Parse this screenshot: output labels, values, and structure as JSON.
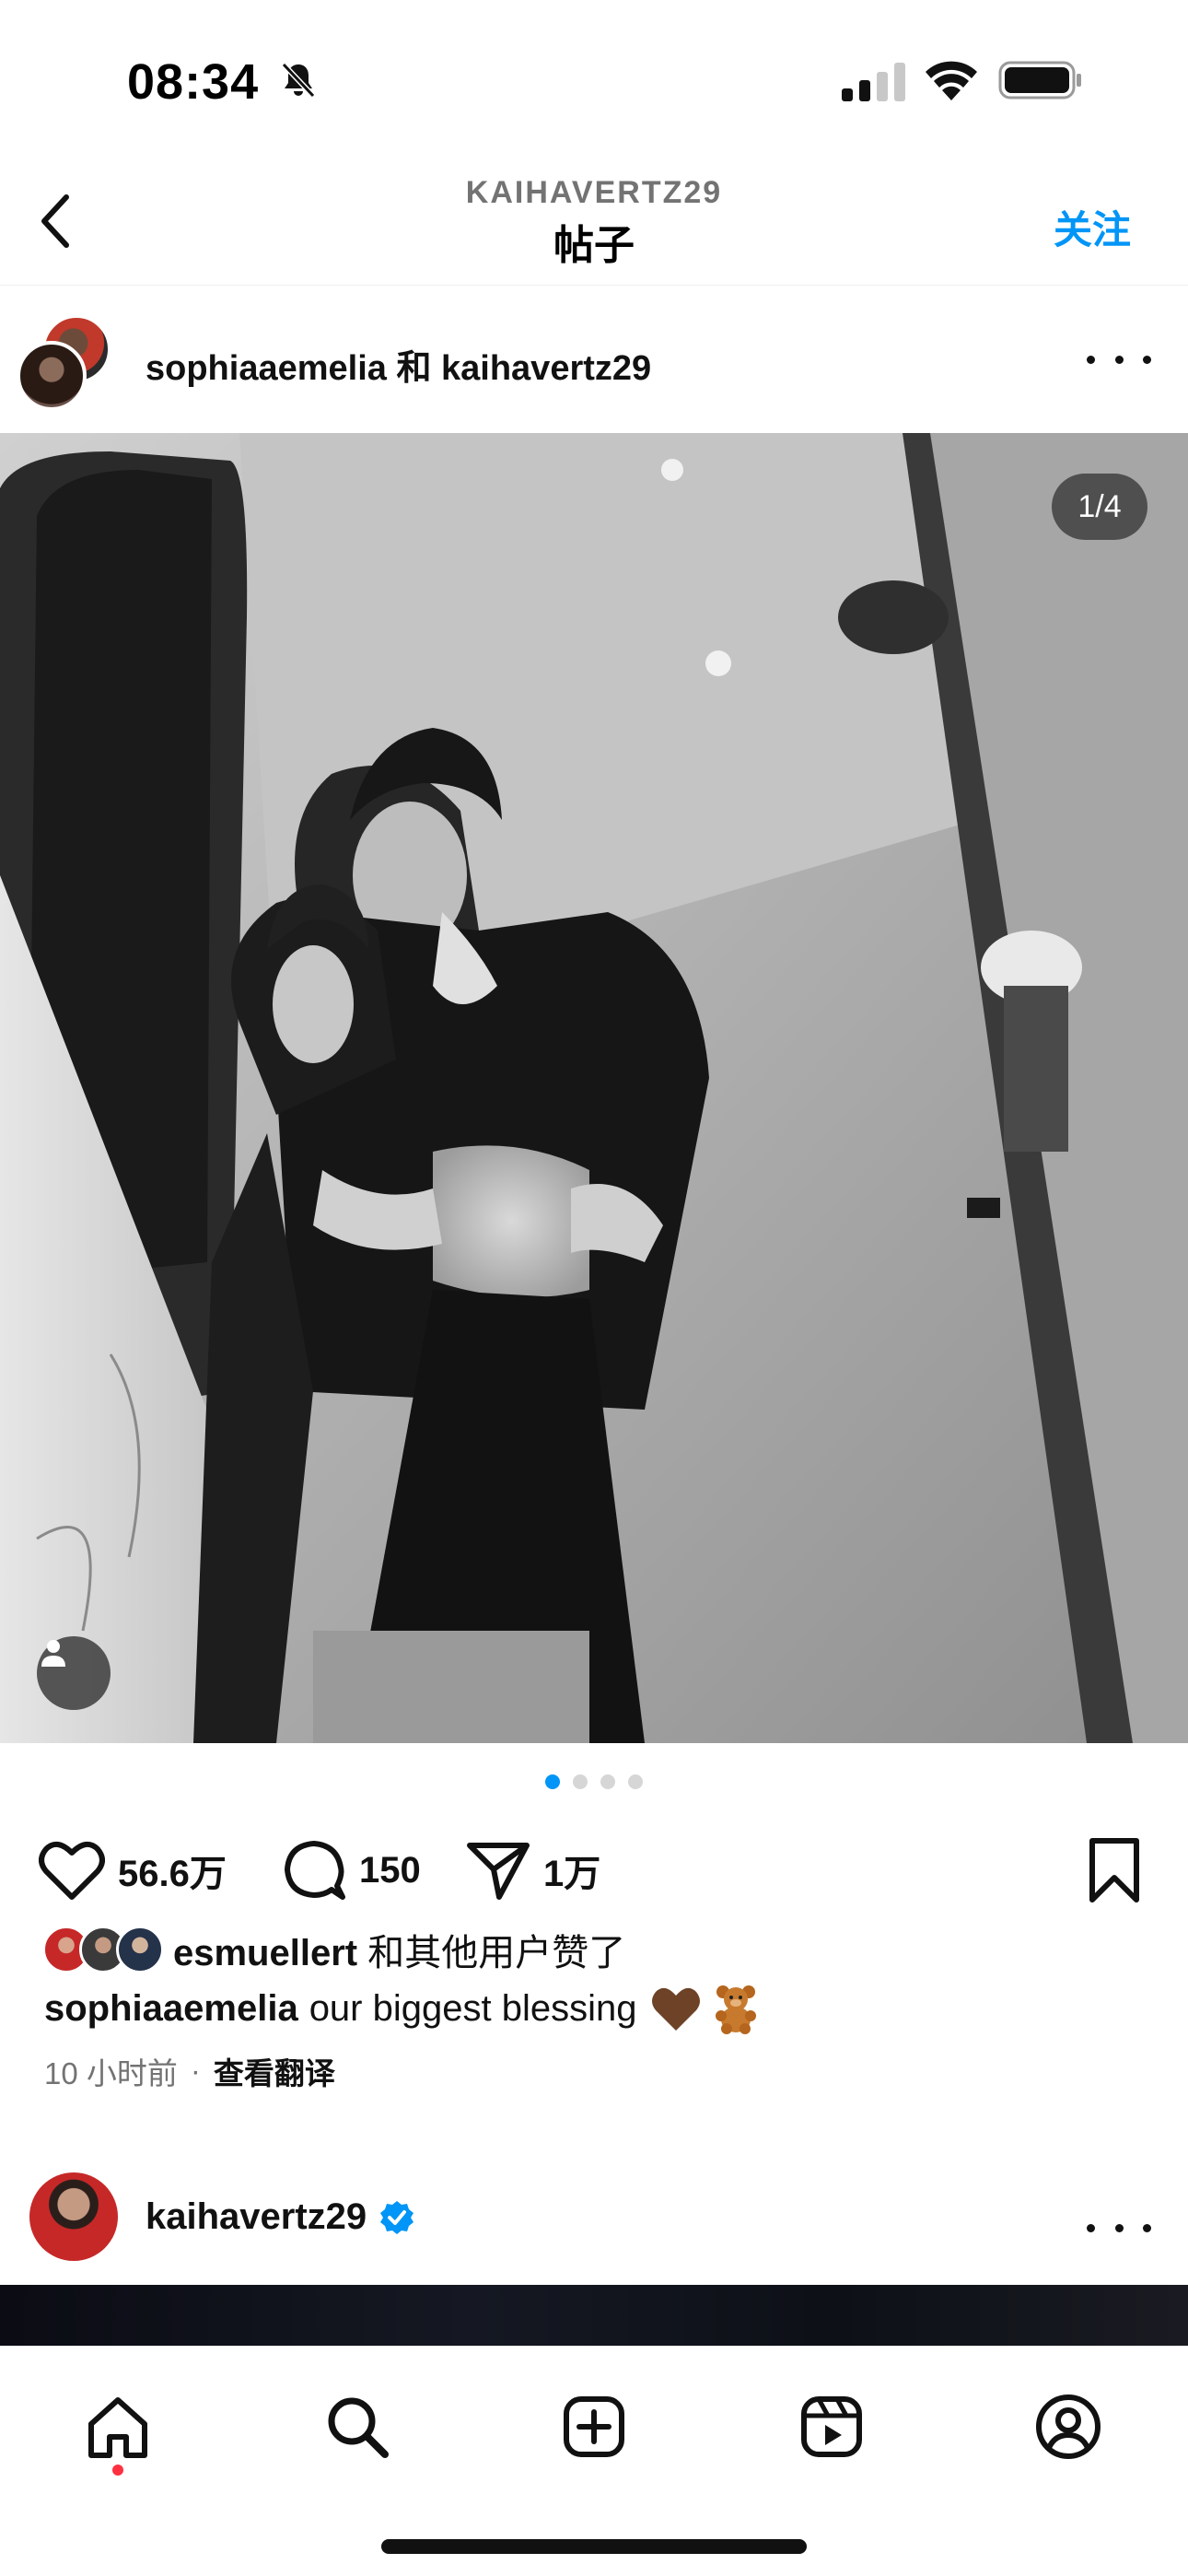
{
  "status_bar": {
    "time": "08:34",
    "icons": [
      "bell-slash-icon",
      "cellular-signal-icon",
      "wifi-icon",
      "battery-icon"
    ]
  },
  "header": {
    "subtitle": "KAIHAVERTZ29",
    "title": "帖子",
    "follow_label": "关注"
  },
  "post": {
    "authors": "sophiaaemelia 和 kaihavertz29",
    "slide_counter": "1/4",
    "slide_count": 4,
    "active_slide": 1,
    "likes": "56.6万",
    "comments": "150",
    "shares": "1万",
    "liked_by_user": "esmuellert",
    "liked_by_suffix": " 和其他用户赞了",
    "caption_user": "sophiaaemelia",
    "caption_text": "our biggest blessing",
    "caption_emojis": [
      "brown-heart-icon",
      "teddy-bear-icon"
    ],
    "timestamp": "10 小时前",
    "separator": "·",
    "translate_label": "查看翻译"
  },
  "next_post": {
    "author": "kaihavertz29",
    "verified": true
  },
  "tabbar": {
    "items": [
      "home-icon",
      "search-icon",
      "create-icon",
      "reels-icon",
      "profile-icon"
    ],
    "active": "home-icon"
  },
  "colors": {
    "accent": "#0095f6",
    "notification_dot": "#ff3040",
    "secondary_text": "#737373"
  }
}
